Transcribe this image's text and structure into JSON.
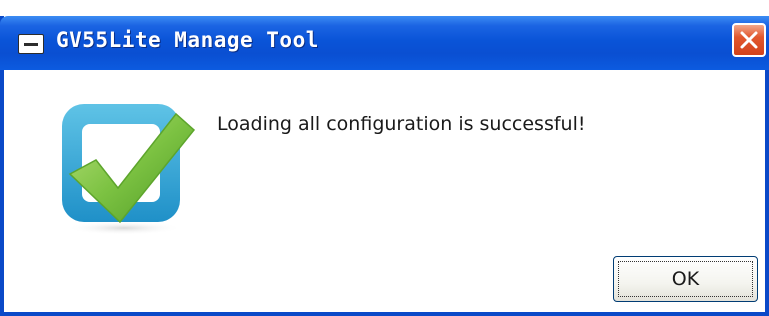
{
  "window": {
    "title": "GV55Lite Manage Tool"
  },
  "titlebar": {
    "system_icon": "window-menu-icon",
    "close_icon": "close-icon",
    "close_color": "#e0512a",
    "accent_color": "#0a54d8"
  },
  "content": {
    "status_icon": "success-checkmark-icon",
    "message": "Loading all configuration is successful!"
  },
  "buttons": {
    "ok_label": "OK"
  }
}
